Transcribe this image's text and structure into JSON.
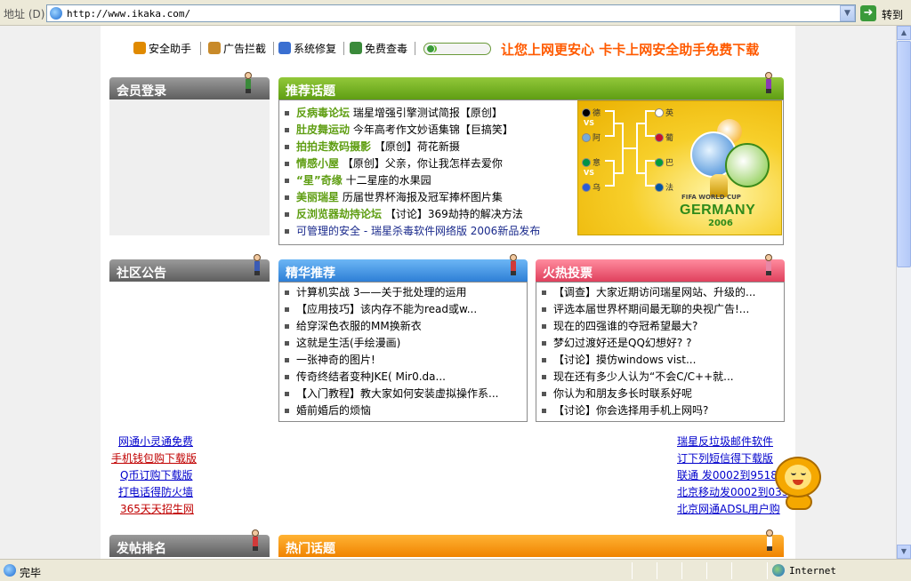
{
  "browser": {
    "address_label": "地址 (D)",
    "url": "http://www.ikaka.com/",
    "go_label": "转到",
    "status_text": "完毕",
    "zone": "Internet"
  },
  "toolbar": {
    "items": [
      {
        "label": "安全助手",
        "icon": "shield-icon",
        "color": "#e08a00"
      },
      {
        "label": "广告拦截",
        "icon": "lock-icon",
        "color": "#c88a2a"
      },
      {
        "label": "系统修复",
        "icon": "wrench-icon",
        "color": "#3a6fd1"
      },
      {
        "label": "免费查毒",
        "icon": "magnifier-icon",
        "color": "#3a8a3a"
      }
    ],
    "slogan": "让您上网更安心 卡卡上网安全助手免费下载",
    "progress": 0.16
  },
  "panels": {
    "member_login": {
      "title": "会员登录"
    },
    "featured_topics": {
      "title": "推荐话题",
      "items": [
        {
          "tag": "反病毒论坛",
          "text": "瑞星增强引擎测试简报【原创】"
        },
        {
          "tag": "肚皮舞运动",
          "text": "今年高考作文妙语集锦【巨搞笑】"
        },
        {
          "tag": "拍拍走数码摄影",
          "text": "【原创】荷花新摄"
        },
        {
          "tag": "情感小屋",
          "text": "【原创】父亲，你让我怎样去爱你"
        },
        {
          "tag": "“星”奇缘",
          "text": "十二星座的水果园"
        },
        {
          "tag": "美丽瑞星",
          "text": "历届世界杯海报及冠军捧杯图片集"
        },
        {
          "tag": "反浏览器劫持论坛",
          "text": "【讨论】369劫持的解决方法"
        },
        {
          "tag": "",
          "text": "可管理的安全 - 瑞星杀毒软件网络版 2006新品发布"
        }
      ],
      "worldcup": {
        "left_flags": [
          "德",
          "阿",
          "意",
          "乌"
        ],
        "right_flags": [
          "英",
          "葡",
          "巴",
          "法"
        ],
        "vs": "VS",
        "caption": "FIFA WORLD CUP",
        "country": "GERMANY",
        "year": "2006"
      }
    },
    "community": {
      "title": "社区公告"
    },
    "essence": {
      "title": "精华推荐",
      "items": [
        "计算机实战 3——关于批处理的运用",
        "【应用技巧】该内存不能为read或w...",
        "给穿深色衣服的MM换新衣",
        "这就是生活(手绘漫画)",
        "一张神奇的图片!",
        "传奇终结者变种JKE( Mir0.da...",
        "【入门教程】教大家如何安装虚拟操作系...",
        "婚前婚后的烦恼"
      ]
    },
    "hot_vote": {
      "title": "火热投票",
      "items": [
        "【调查】大家近期访问瑞星网站、升级的...",
        "评选本届世界杯期间最无聊的央视广告!...",
        "现在的四强谁的夺冠希望最大?",
        "梦幻过渡好还是QQ幻想好? ?",
        "【讨论】摸仿windows vist...",
        "现在还有多少人认为“不会C/C++就...",
        "你认为和朋友多长时联系好呢",
        "【讨论】你会选择用手机上网吗?"
      ]
    },
    "post_rank": {
      "title": "发帖排名"
    },
    "hot_topics": {
      "title": "热门话题"
    }
  },
  "left_links": [
    {
      "text": "网通小灵通免费",
      "color": "#0000cc"
    },
    {
      "text": "手机钱包购下载版",
      "color": "#c00000"
    },
    {
      "text": "Q币订购下载版",
      "color": "#0000cc"
    },
    {
      "text": "打电话得防火墙",
      "color": "#0000cc"
    },
    {
      "text": "365天天招生网",
      "color": "#c00000"
    }
  ],
  "right_links": [
    {
      "text": "瑞星反垃圾邮件软件",
      "color": "#0000cc"
    },
    {
      "text": "订下列短信得下载版",
      "color": "#0000cc"
    },
    {
      "text": "联通 发0002到9518",
      "color": "#0000cc"
    },
    {
      "text": "北京移动发0002到033",
      "color": "#0000cc"
    },
    {
      "text": "北京网通ADSL用户购",
      "color": "#0000cc"
    }
  ]
}
